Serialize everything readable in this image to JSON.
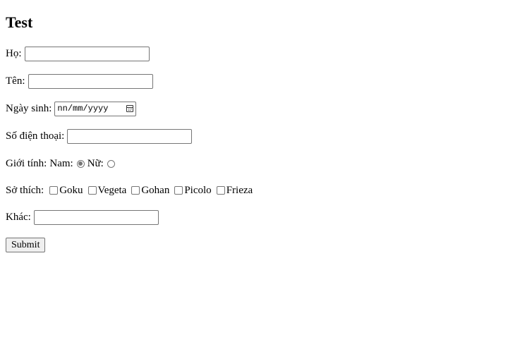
{
  "form": {
    "title": "Test",
    "ho_label": "Họ:",
    "ten_label": "Tên:",
    "ngaysinh_label": "Ngày sinh:",
    "date_placeholder": "nn/mm/yyyy",
    "sdt_label": "Số điện thoại:",
    "gioitinh_label": "Giới tính:",
    "gender_options": [
      "Nam:",
      "Nữ:"
    ],
    "gender_selected": "Nam",
    "sothich_label": "Sở thích:",
    "hobbies": [
      "Goku",
      "Vegeta",
      "Gohan",
      "Picolo",
      "Frieza"
    ],
    "khac_label": "Khác:",
    "submit_label": "Submit"
  }
}
